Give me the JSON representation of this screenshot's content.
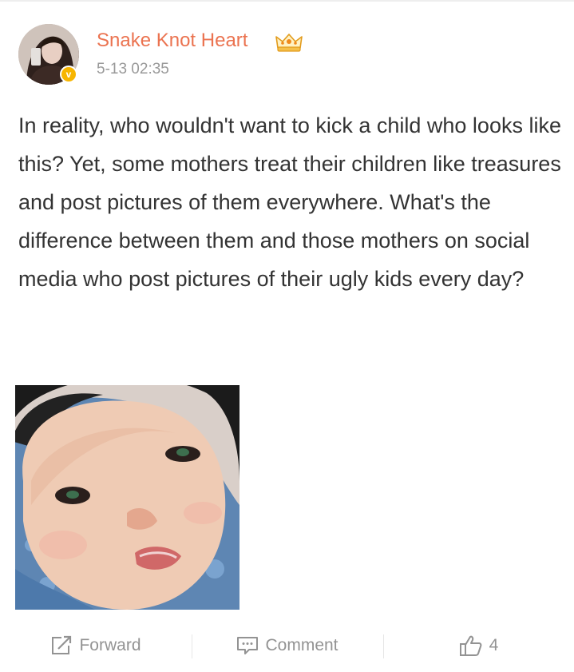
{
  "post": {
    "username": "Snake Knot Heart",
    "timestamp": "5-13 02:35",
    "text": "In reality, who wouldn't want to kick a child who looks like this? Yet, some mothers treat their children like treasures and post pictures of them everywhere. What's the difference between them and those mothers on social media who post pictures of their ugly kids every day?",
    "avatar_icon": "user-avatar",
    "verified_badge_icon": "verified-icon",
    "member_icon": "crown-icon"
  },
  "actions": {
    "forward_label": "Forward",
    "comment_label": "Comment",
    "like_count": "4"
  },
  "colors": {
    "username": "#eb7350",
    "verified_badge": "#f7b500",
    "action_text": "#939393"
  }
}
